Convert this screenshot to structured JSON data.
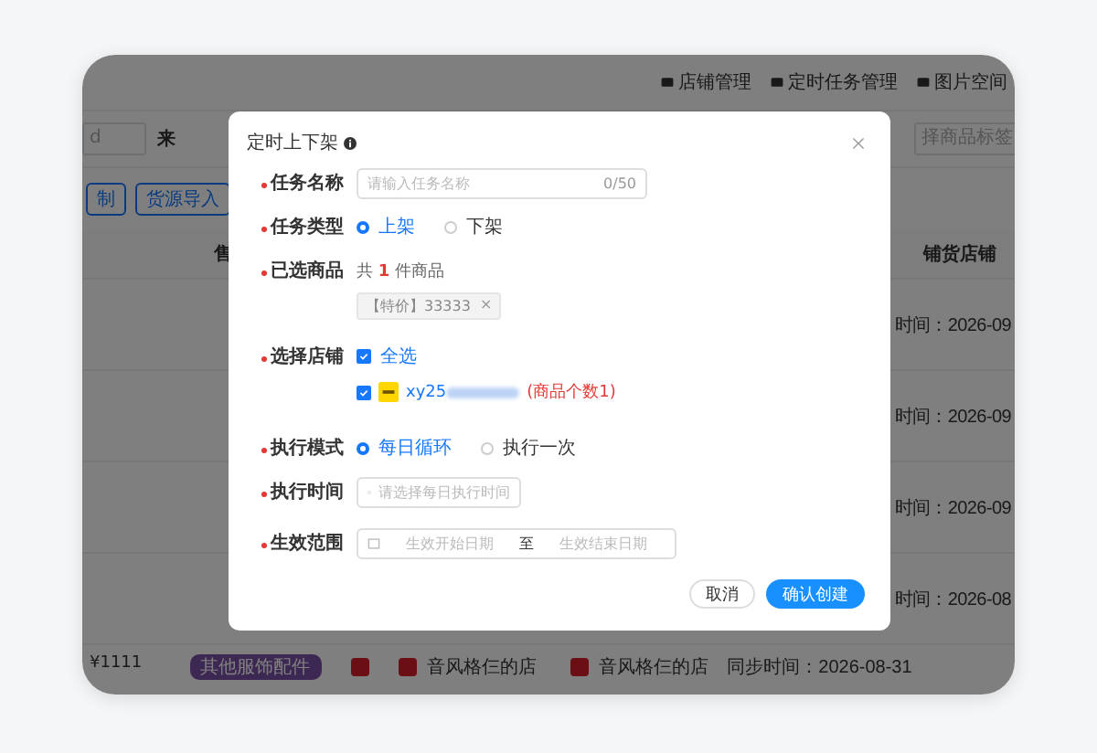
{
  "app": {
    "nav_links": [
      {
        "label": "店铺管理"
      },
      {
        "label": "定时任务管理"
      },
      {
        "label": "图片空间"
      }
    ],
    "filter": {
      "left_placeholder": "d",
      "label": "来",
      "right_placeholder": "择商品标签"
    },
    "buttons": [
      {
        "label": "制"
      },
      {
        "label": "货源导入"
      }
    ],
    "table": {
      "columns": [
        "售",
        "铺货店铺"
      ],
      "rows": [
        {
          "sync": "时间：2026-09"
        },
        {
          "sync": "时间：2026-09"
        },
        {
          "sync": "时间：2026-09"
        },
        {
          "sync": "时间：2026-08"
        }
      ],
      "last_row": {
        "price": "¥1111",
        "category": "其他服饰配件",
        "store_1": "音风格仨的店",
        "store_2": "音风格仨的店",
        "sync": "同步时间：2026-08-31"
      }
    }
  },
  "dialog": {
    "title": "定时上下架",
    "task_name": {
      "label": "任务名称",
      "placeholder": "请输入任务名称",
      "counter": "0/50"
    },
    "task_type": {
      "label": "任务类型",
      "options": [
        {
          "label": "上架",
          "selected": true
        },
        {
          "label": "下架",
          "selected": false
        }
      ]
    },
    "products": {
      "label": "已选商品",
      "summary_prefix": "共",
      "count": "1",
      "summary_suffix": "件商品",
      "tags": [
        {
          "label": "【特价】33333",
          "close": "×"
        }
      ]
    },
    "stores": {
      "label": "选择店铺",
      "select_all": {
        "label": "全选",
        "checked": true
      },
      "items": [
        {
          "name": "xy25",
          "count_text": "(商品个数1)",
          "checked": true
        }
      ]
    },
    "mode": {
      "label": "执行模式",
      "options": [
        {
          "label": "每日循环",
          "selected": true
        },
        {
          "label": "执行一次",
          "selected": false
        }
      ]
    },
    "time": {
      "label": "执行时间",
      "placeholder": "请选择每日执行时间"
    },
    "range": {
      "label": "生效范围",
      "start_placeholder": "生效开始日期",
      "separator": "至",
      "end_placeholder": "生效结束日期"
    },
    "cancel": "取消",
    "confirm": "确认创建"
  }
}
